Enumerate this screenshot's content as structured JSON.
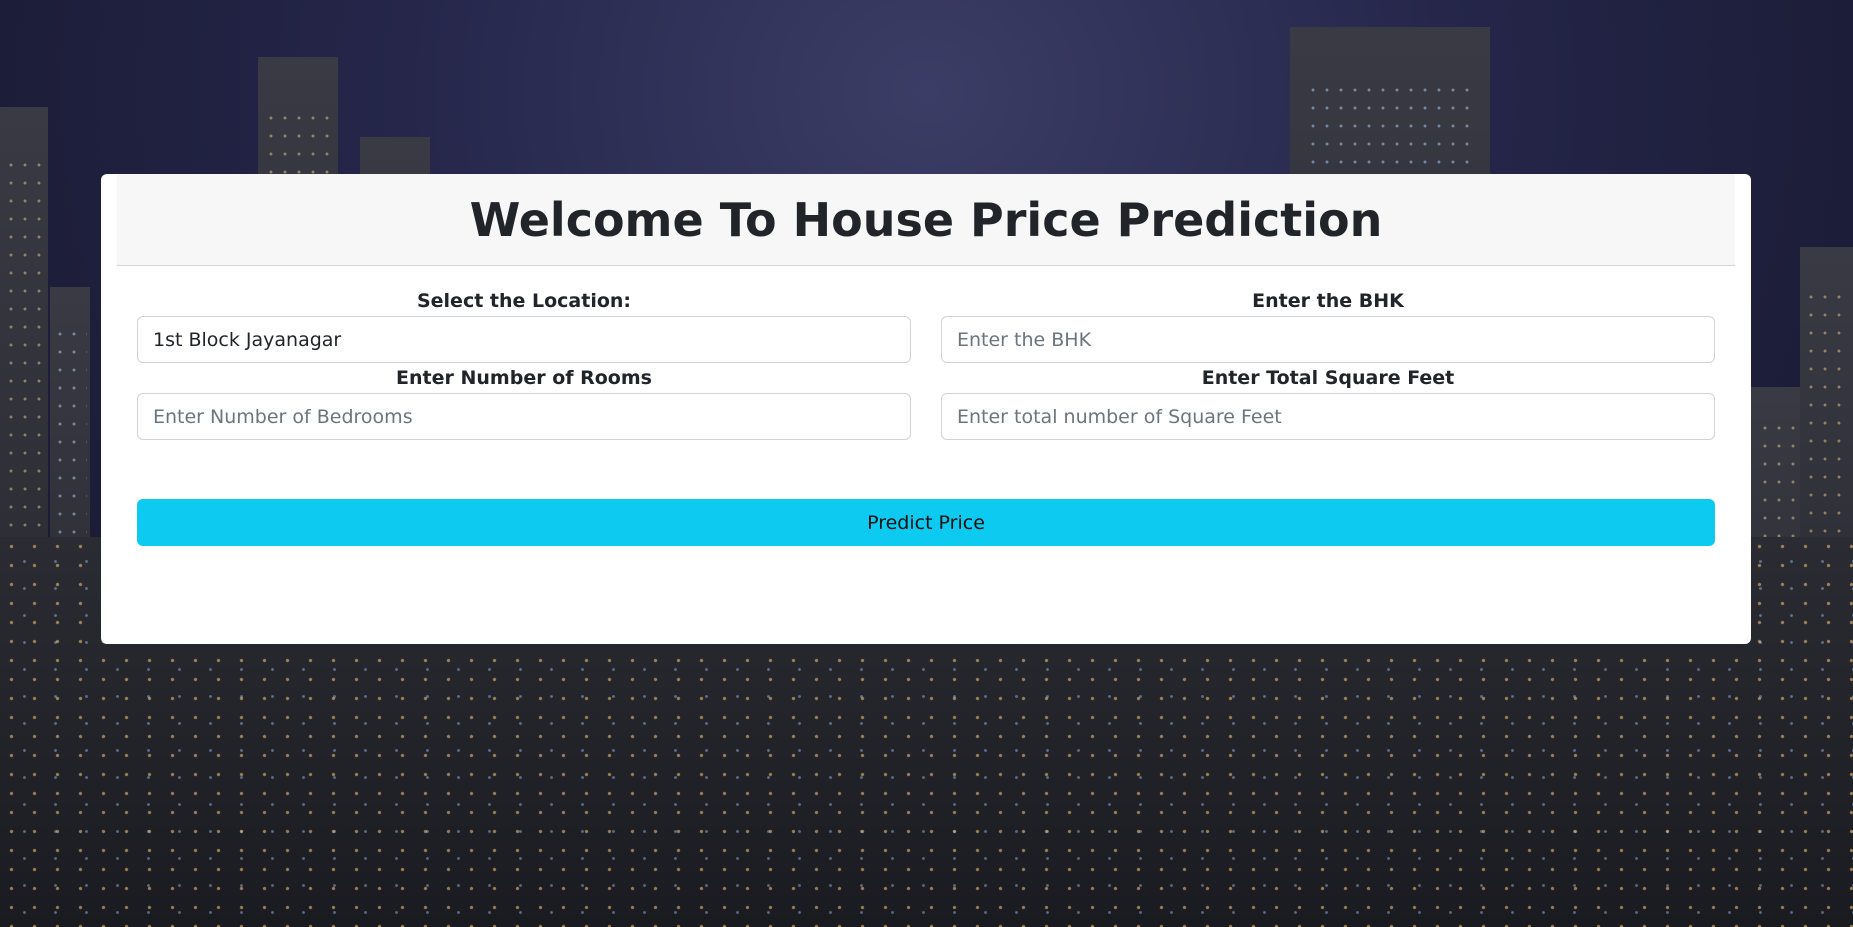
{
  "page": {
    "title": "Welcome To House Price Prediction"
  },
  "form": {
    "location": {
      "label": "Select the Location:",
      "value": "1st Block Jayanagar"
    },
    "bhk": {
      "label": "Enter the BHK",
      "placeholder": "Enter the BHK"
    },
    "rooms": {
      "label": "Enter Number of Rooms",
      "placeholder": "Enter Number of Bedrooms"
    },
    "sqft": {
      "label": "Enter Total Square Feet",
      "placeholder": "Enter total number of Square Feet"
    },
    "submit_label": "Predict Price",
    "result_text": ""
  },
  "colors": {
    "button": "#0dcaf0",
    "header_bg": "#f7f7f7",
    "card_bg": "#ffffff",
    "text": "#212529"
  }
}
